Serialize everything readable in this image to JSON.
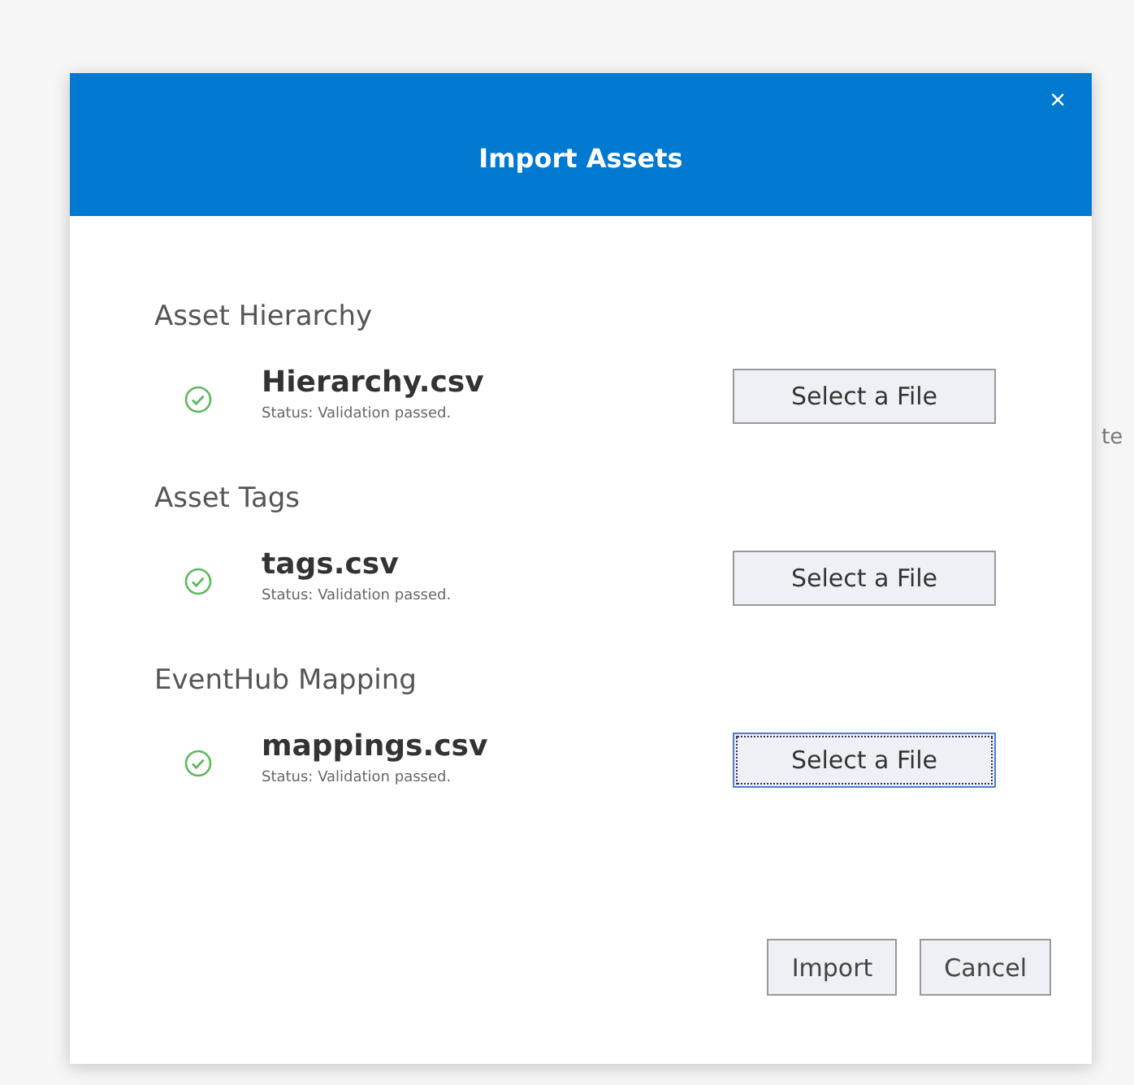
{
  "background_text": "te",
  "dialog": {
    "title": "Import Assets",
    "close": "×"
  },
  "sections": [
    {
      "label": "Asset Hierarchy",
      "file": "Hierarchy.csv",
      "status": "Status: Validation passed.",
      "valid": true,
      "button": "Select a File",
      "focused": false
    },
    {
      "label": "Asset Tags",
      "file": "tags.csv",
      "status": "Status: Validation passed.",
      "valid": true,
      "button": "Select a File",
      "focused": false
    },
    {
      "label": "EventHub Mapping",
      "file": "mappings.csv",
      "status": "Status: Validation passed.",
      "valid": true,
      "button": "Select a File",
      "focused": true
    }
  ],
  "buttons": [
    {
      "label": "Import"
    },
    {
      "label": "Cancel"
    }
  ]
}
